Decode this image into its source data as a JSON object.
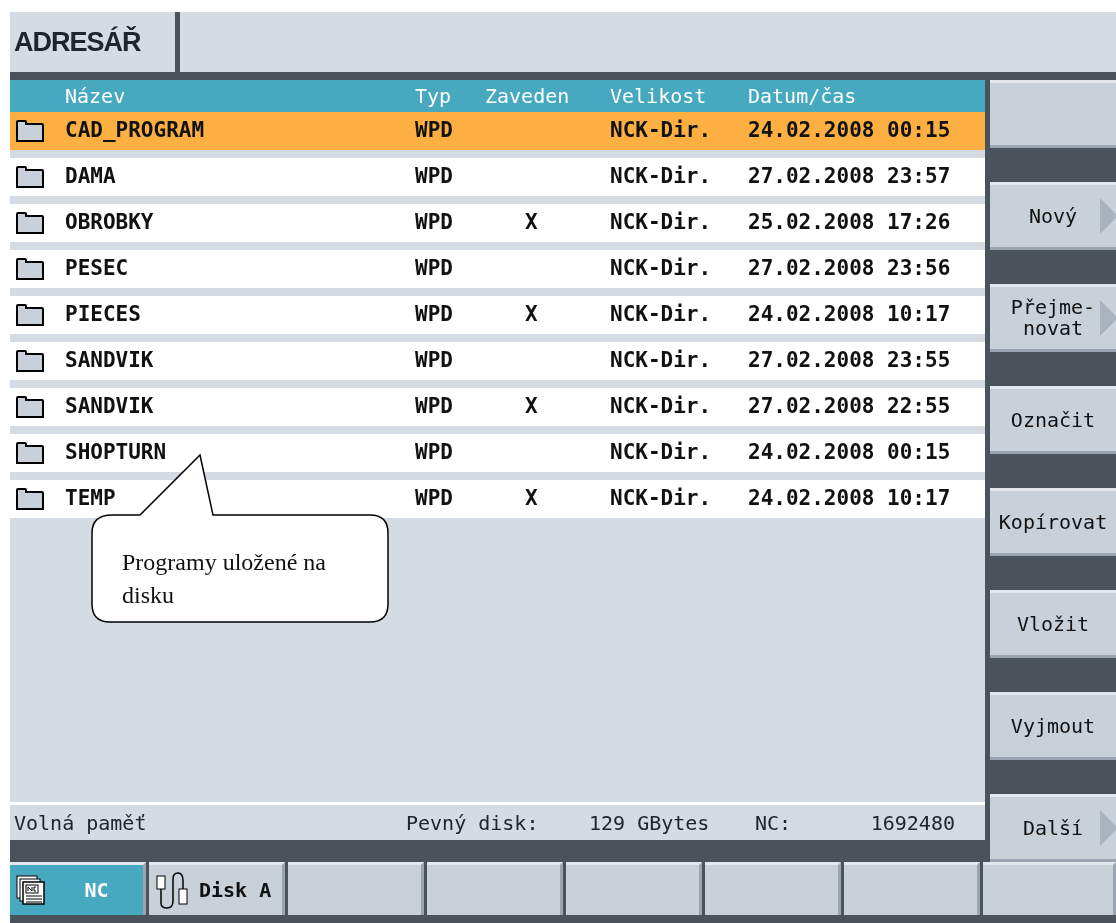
{
  "title": "ADRESÁŘ",
  "table": {
    "columns": [
      "Název",
      "Typ",
      "Zaveden",
      "Velikost",
      "Datum/čas"
    ],
    "rows": [
      {
        "name": "CAD_PROGRAM",
        "type": "WPD",
        "size": "NCK-Dir.",
        "date": "24.02.2008 00:15",
        "selected": true
      },
      {
        "name": "DAMA",
        "type": "WPD",
        "size": "NCK-Dir.",
        "date": "27.02.2008 23:57",
        "selected": false
      },
      {
        "name": "OBROBKY",
        "type": "WPD",
        "loaded": "X",
        "size": "NCK-Dir.",
        "date": "25.02.2008 17:26",
        "selected": false
      },
      {
        "name": "PESEC",
        "type": "WPD",
        "size": "NCK-Dir.",
        "date": "27.02.2008 23:56",
        "selected": false
      },
      {
        "name": "PIECES",
        "type": "WPD",
        "loaded": "X",
        "size": "NCK-Dir.",
        "date": "24.02.2008 10:17",
        "selected": false
      },
      {
        "name": "SANDVIK",
        "type": "WPD",
        "size": "NCK-Dir.",
        "date": "27.02.2008 23:55",
        "selected": false
      },
      {
        "name": "SANDVIK",
        "type": "WPD",
        "loaded": "X",
        "size": "NCK-Dir.",
        "date": "27.02.2008 22:55",
        "selected": false
      },
      {
        "name": "SHOPTURN",
        "type": "WPD",
        "size": "NCK-Dir.",
        "date": "24.02.2008 00:15",
        "selected": false
      },
      {
        "name": "TEMP",
        "type": "WPD",
        "loaded": "X",
        "size": "NCK-Dir.",
        "date": "24.02.2008 10:17",
        "selected": false
      }
    ]
  },
  "status_bar": {
    "label": "Volná paměť",
    "disk_label": "Pevný disk:",
    "disk_value": "129 GBytes",
    "nc_label": "NC:",
    "nc_value": "1692480"
  },
  "softkeys": [
    {
      "arrow": false
    },
    {
      "label": "Nový",
      "arrow": true
    },
    {
      "label": "Přejme-\nnovat",
      "arrow": true
    },
    {
      "label": "Označit",
      "arrow": false
    },
    {
      "label": "Kopírovat",
      "arrow": false
    },
    {
      "label": "Vložit",
      "arrow": false
    },
    {
      "label": "Vyjmout",
      "arrow": false
    },
    {
      "label": "Další",
      "arrow": true
    }
  ],
  "bottom_tabs": [
    {
      "label": "NC",
      "kind": "nc",
      "selected": true
    },
    {
      "label": "Disk A",
      "kind": "usb",
      "selected": false
    },
    {
      "selected": false
    },
    {
      "selected": false
    },
    {
      "selected": false
    },
    {
      "selected": false
    },
    {
      "selected": false
    },
    {
      "selected": false
    }
  ],
  "callout": {
    "text": "Programy uložené na disku"
  }
}
